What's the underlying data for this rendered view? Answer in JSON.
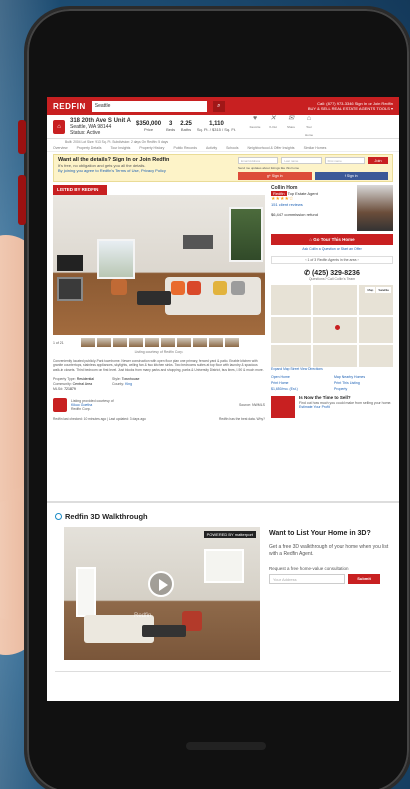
{
  "app": {
    "logo": "REDFIN",
    "search_value": "Seattle",
    "search_icon": "search-icon",
    "header_right_1": "Call: (877) 973-3346   Sign In or Join Redfin",
    "header_right_2": "BUY & SELL   REAL ESTATE AGENTS   TOOLS ▾",
    "accent": "#c82021"
  },
  "property": {
    "address_line1": "318 20th Ave S Unit A",
    "address_line2": "Seattle, WA 98144",
    "status": "Status: Active",
    "built": "Built: 2004   Lot Size: 913 Sq. Ft.   Subdivision: 2 days   On Redfin: 5 days",
    "price": "$350,000",
    "price_label": "Price",
    "beds": "3",
    "beds_label": "Beds",
    "baths": "2.25",
    "baths_label": "Baths",
    "sqft": "1,110",
    "sqft_label": "Sq. Ft. / $315 / Sq. Ft.",
    "actions": [
      {
        "label": "Favorite",
        "icon": "heart-icon"
      },
      {
        "label": "X-Out",
        "icon": "close-icon"
      },
      {
        "label": "Share",
        "icon": "mail-icon"
      },
      {
        "label": "Tour Home",
        "icon": "house-icon"
      }
    ]
  },
  "tabs": [
    "Overview",
    "Property Details",
    "Tour Insights",
    "Property History",
    "Public Records",
    "Activity",
    "Schools",
    "Neighborhood & Offer Insights",
    "Similar Homes"
  ],
  "banner": {
    "title": "Want all the details? Sign In or Join Redfin",
    "line1": "It's free, no obligation and gets you all the details.",
    "line2": "By joining you agree to Redfin's Terms of Use, Privacy Policy",
    "email_placeholder": "Email Address",
    "password_placeholder": "Last name",
    "first_placeholder": "First name",
    "join": "Join",
    "checkbox": "Send me updates about listings like this home",
    "google": "Sign in",
    "facebook": "Sign in"
  },
  "listing": {
    "listed_by": "LISTED BY REDFIN",
    "photo_count": "1 of 21",
    "caption": "Listing courtesy of Redfin Corp.",
    "description": "Conveniently located publicly-Park townhome. Newer construction with open floor plan one primary, fenced yard & patio. Enable kitchen with granite countertops, stainless appliances, skylights, ceiling fan & two kitchen sinks. Two bedrooms suites at top floor with laundry & spacious walk-in closets. Third bedroom on first level. Just blocks from many parks and shopping, parks & University District, bus lines, I-90 & much more.",
    "property_type_label": "Property Type:",
    "property_type": "Residential",
    "community_label": "Community:",
    "community": "Central Area",
    "mls_label": "MLS#:",
    "mls": "721879",
    "style_label": "Style:",
    "style": "Townhouse",
    "county_label": "County:",
    "county": "King",
    "agent_label": "Listing provided courtesy of",
    "agent_name": "Kikuo Goetha",
    "agent_firm": "Redfin Corp.",
    "source": "Source: NWMLS",
    "last_checked": "Redfin last checked: 10 minutes ago   |   Last updated: 3 days ago",
    "last_checked_right": "Redfin has the best data. Why?"
  },
  "agent_card": {
    "name": "Collin Hom",
    "badge": "Redfin",
    "role": "Top Estate Agent",
    "reviews": "151 client reviews",
    "refund": "$6,447 commission refund",
    "tour_button": "Go Tour This Home",
    "ask": "Ask Collin a Question or Start an Offer",
    "pager": "1 of 3 Redfin Agents in the area",
    "phone": "(425) 329-8236",
    "questions": "Questions? Call Collin's Team",
    "map_tab1": "Map",
    "map_tab2": "Satellite",
    "map_links": "Expand Map   Street View   Directions",
    "links": [
      "Open Home",
      "Map Nearby Homes",
      "Print Home",
      "Print This Listing",
      "$1,650/mo. (Est.)",
      "Property"
    ],
    "sell_title": "Is Now the Time to Sell?",
    "sell_text": "Find out how much you could make from selling your home.",
    "sell_link": "Estimate Your Profit"
  },
  "walkthrough": {
    "title": "Redfin 3D Walkthrough",
    "powered": "POWERED BY matterport",
    "watermark": "Redfin",
    "side_title": "Want to List Your Home in 3D?",
    "side_text": "Get a free 3D walkthrough of your home when you list with a Redfin Agent.",
    "request": "Request a free home-value consultation",
    "address_placeholder": "Your Address",
    "submit": "Submit"
  }
}
